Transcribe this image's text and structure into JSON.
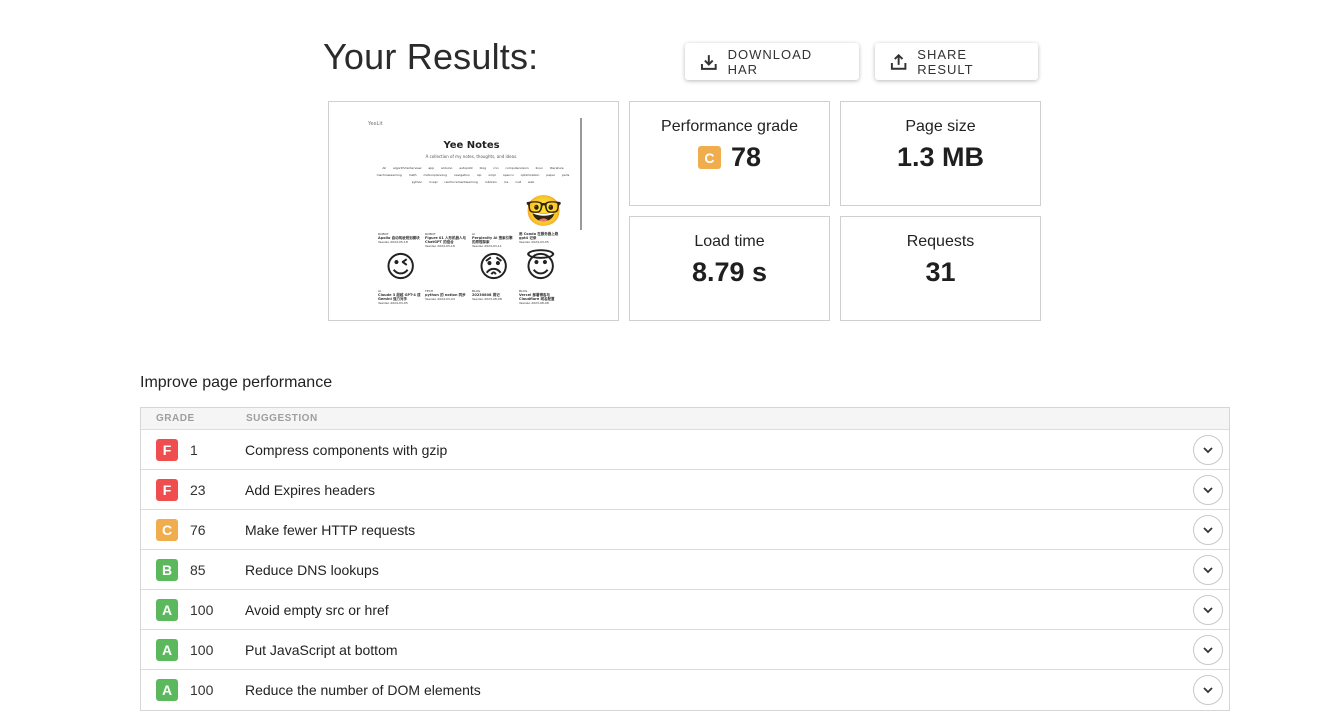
{
  "header": {
    "title": "Your Results:",
    "download_label": "DOWNLOAD HAR",
    "share_label": "SHARE RESULT"
  },
  "thumbnail": {
    "brand": "Yee",
    "brand_suffix": "Lit",
    "title": "Yee Notes",
    "subtitle": "A collection of my notes, thoughts, and ideas.",
    "tags": "All algorithminterview app arduino autopilot blog cnn computervision linux literature machinelearning math motionplanning navigation nlp ompl opencv optimization paper perls python ricepi reinforcementlearning robotics ros rust web",
    "posts": [
      {
        "cat": "ROBOT",
        "title": "Apollo 自动驾驶规划模块",
        "date": "Yeexiao 2024-05-18"
      },
      {
        "cat": "ROBOT",
        "title": "Figure 01 人形机器人与 ChatGPT 的结合",
        "date": "Yeexiao 2024-03-18"
      },
      {
        "cat": "AI",
        "title": "Perplexity AI 搜索引擎的原理探索",
        "date": "Yeexiao 2024-03-11"
      },
      {
        "cat": "",
        "title": "用 Conda 在服务器上跑 gpt4 记录",
        "date": "Yeexiao 2024-03-05"
      },
      {
        "cat": "AI",
        "title": "Claude 3 超越 GPT-4 成 Gemini 强力对手",
        "date": "Yeexiao 2024-03-05"
      },
      {
        "cat": "TECH",
        "title": "python 的 notion 同步",
        "date": "Yeexiao 2024-03-04"
      },
      {
        "cat": "BLOG",
        "title": "20230808 周记",
        "date": "Yeexiao 2023-08-08"
      },
      {
        "cat": "BLOG",
        "title": "Vercel 部署博客与 Cloudflare 域名配置",
        "date": "Yeexiao 2023-08-08"
      }
    ]
  },
  "metrics": {
    "grade_label": "Performance grade",
    "grade_letter": "C",
    "grade_value": "78",
    "size_label": "Page size",
    "size_value": "1.3 MB",
    "load_label": "Load time",
    "load_value": "8.79 s",
    "requests_label": "Requests",
    "requests_value": "31"
  },
  "improve": {
    "title": "Improve page performance",
    "col_grade": "GRADE",
    "col_suggestion": "SUGGESTION",
    "rows": [
      {
        "grade": "F",
        "score": "1",
        "suggestion": "Compress components with gzip"
      },
      {
        "grade": "F",
        "score": "23",
        "suggestion": "Add Expires headers"
      },
      {
        "grade": "C",
        "score": "76",
        "suggestion": "Make fewer HTTP requests"
      },
      {
        "grade": "B",
        "score": "85",
        "suggestion": "Reduce DNS lookups"
      },
      {
        "grade": "A",
        "score": "100",
        "suggestion": "Avoid empty src or href"
      },
      {
        "grade": "A",
        "score": "100",
        "suggestion": "Put JavaScript at bottom"
      },
      {
        "grade": "A",
        "score": "100",
        "suggestion": "Reduce the number of DOM elements"
      }
    ]
  },
  "colors": {
    "grade_A": "#5cb85c",
    "grade_B": "#5cb85c",
    "grade_C": "#f0ad4e",
    "grade_F": "#f04e4e"
  },
  "icons": {
    "download": "download-icon",
    "share": "share-icon",
    "expand": "chevron-down-icon"
  }
}
